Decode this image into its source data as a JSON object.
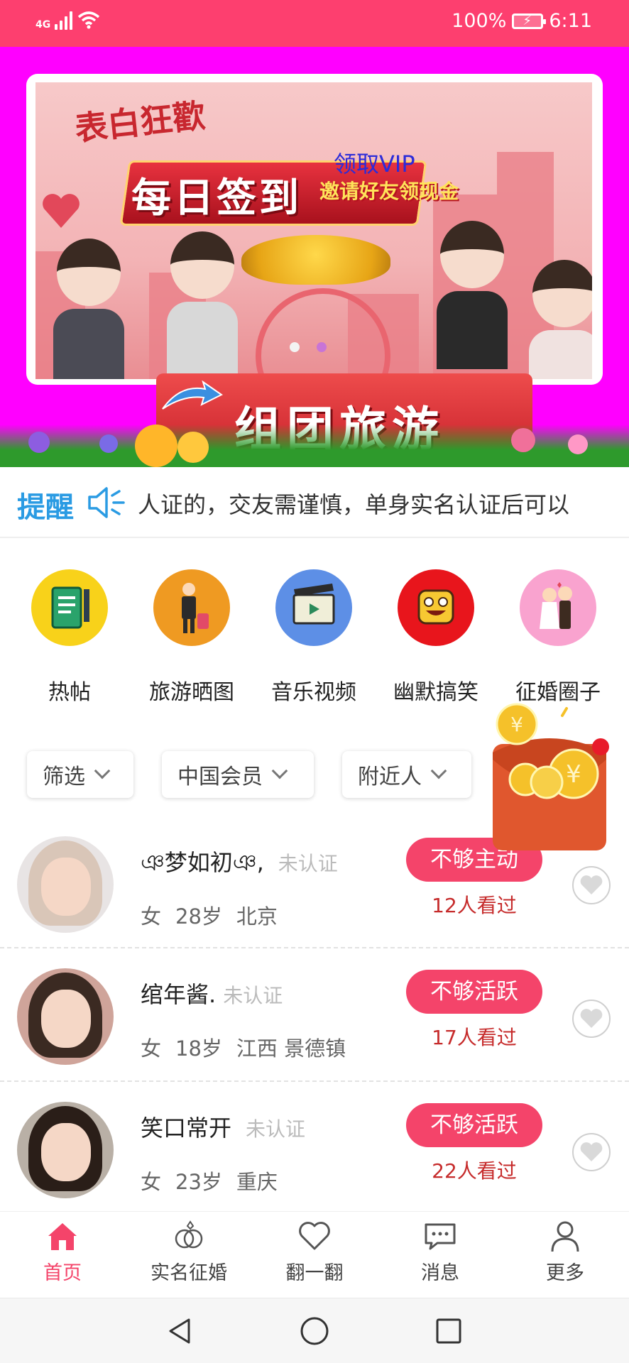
{
  "status_bar": {
    "network": "4G",
    "battery": "100%",
    "time": "6:11"
  },
  "banner": {
    "headline": "表白狂歡",
    "main_text": "每日签到",
    "vip_text": "领取VIP",
    "invite_text": "邀请好友领现金",
    "bottom_text": "组团旅游",
    "page_count": 2,
    "active_page": 1
  },
  "notice": {
    "title": "提醒",
    "text": "人证的，交友需谨慎，单身实名认证后可以"
  },
  "categories": [
    {
      "label": "热帖",
      "icon": "notebook-icon",
      "color": "#f8d21a"
    },
    {
      "label": "旅游晒图",
      "icon": "traveler-icon",
      "color": "#ef9a22"
    },
    {
      "label": "音乐视频",
      "icon": "video-icon",
      "color": "#5d8fe6"
    },
    {
      "label": "幽默搞笑",
      "icon": "funny-face-icon",
      "color": "#e8151c"
    },
    {
      "label": "征婚圈子",
      "icon": "couple-icon",
      "color": "#f9a3cf"
    }
  ],
  "filters": [
    {
      "label": "筛选"
    },
    {
      "label": "中国会员"
    },
    {
      "label": "附近人"
    }
  ],
  "users": [
    {
      "name": "ঞ梦如初ঞ,",
      "cert": "未认证",
      "gender": "女",
      "age": "28岁",
      "location": "北京",
      "tag": "不够主动",
      "views": "12人看过"
    },
    {
      "name": "绾年酱.",
      "cert": "未认证",
      "gender": "女",
      "age": "18岁",
      "location": "江西 景德镇",
      "tag": "不够活跃",
      "views": "17人看过"
    },
    {
      "name": "笑口常开",
      "cert": "未认证",
      "gender": "女",
      "age": "23岁",
      "location": "重庆",
      "tag": "不够活跃",
      "views": "22人看过"
    }
  ],
  "tabs": [
    {
      "label": "首页",
      "icon": "home-icon",
      "active": true
    },
    {
      "label": "实名征婚",
      "icon": "rings-icon",
      "active": false
    },
    {
      "label": "翻一翻",
      "icon": "heart-icon",
      "active": false
    },
    {
      "label": "消息",
      "icon": "message-icon",
      "active": false
    },
    {
      "label": "更多",
      "icon": "person-icon",
      "active": false
    }
  ],
  "colors": {
    "accent": "#f4446a",
    "status_bar": "#fd3f6f",
    "banner_bg": "#ff00ff",
    "notice_title": "#2a9be3",
    "views_text": "#c62b2b"
  }
}
